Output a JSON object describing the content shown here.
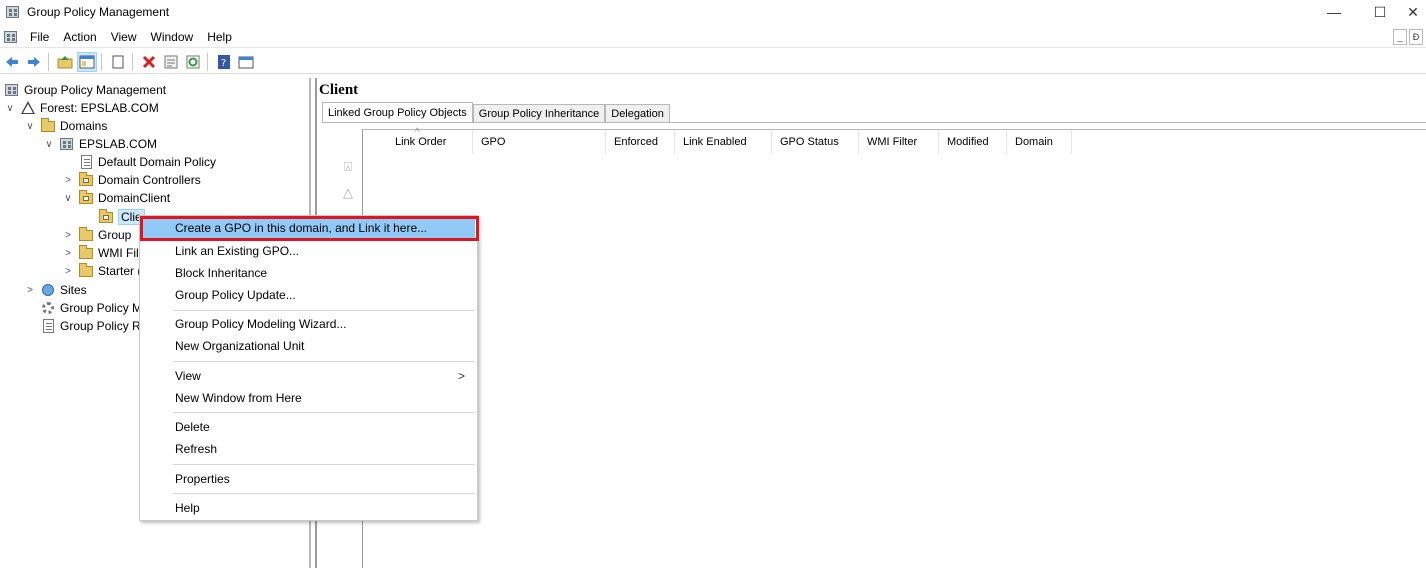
{
  "window": {
    "title": "Group Policy Management",
    "minimize_glyph": "—",
    "maximize_glyph": "☐",
    "close_glyph": "✕"
  },
  "menubar": {
    "items": [
      "File",
      "Action",
      "View",
      "Window",
      "Help"
    ],
    "mdi_minimize": "_",
    "mdi_restore": "Ɖ"
  },
  "toolbar": {
    "icons": [
      "back-arrow-icon",
      "forward-arrow-icon",
      "up-folder-icon",
      "show-tree-icon",
      "copy-icon",
      "delete-icon",
      "properties-icon",
      "refresh-icon",
      "help-icon",
      "export-list-icon"
    ]
  },
  "tree": {
    "items": [
      {
        "label": "Group Policy Management",
        "icon": "gpm-icon"
      },
      {
        "label": "Forest: EPSLAB.COM",
        "icon": "forest-icon"
      },
      {
        "label": "Domains",
        "icon": "domains-icon"
      },
      {
        "label": "EPSLAB.COM",
        "icon": "domain-icon"
      },
      {
        "label": "Default Domain Policy",
        "icon": "gpo-link-icon"
      },
      {
        "label": "Domain Controllers",
        "icon": "ou-icon"
      },
      {
        "label": "DomainClient",
        "icon": "ou-icon"
      },
      {
        "label": "Clie",
        "icon": "ou-icon"
      },
      {
        "label": "Group",
        "icon": "gpo-folder-icon"
      },
      {
        "label": "WMI Fil",
        "icon": "wmi-folder-icon"
      },
      {
        "label": "Starter (",
        "icon": "starter-folder-icon"
      },
      {
        "label": "Sites",
        "icon": "sites-icon"
      },
      {
        "label": "Group Policy M",
        "icon": "modeling-icon"
      },
      {
        "label": "Group Policy R",
        "icon": "results-icon"
      }
    ],
    "expand_glyph": "∨",
    "collapse_glyph": ">"
  },
  "right_pane": {
    "title": "Client",
    "tabs": [
      "Linked Group Policy Objects",
      "Group Policy Inheritance",
      "Delegation"
    ],
    "columns": [
      "Link Order",
      "GPO",
      "Enforced",
      "Link Enabled",
      "GPO Status",
      "WMI Filter",
      "Modified",
      "Domain"
    ],
    "sort_indicator": "^",
    "move_top_glyph": "⍓",
    "move_up_glyph": "△"
  },
  "context_menu": {
    "items": [
      "Create a GPO in this domain, and Link it here...",
      "Link an Existing GPO...",
      "Block Inheritance",
      "Group Policy Update...",
      "Group Policy Modeling Wizard...",
      "New Organizational Unit",
      "View",
      "New Window from Here",
      "Delete",
      "Refresh",
      "Properties",
      "Help"
    ],
    "submenu_glyph": ">",
    "highlight_color": "#91c9f7",
    "focus_border_color": "#e0161e"
  }
}
